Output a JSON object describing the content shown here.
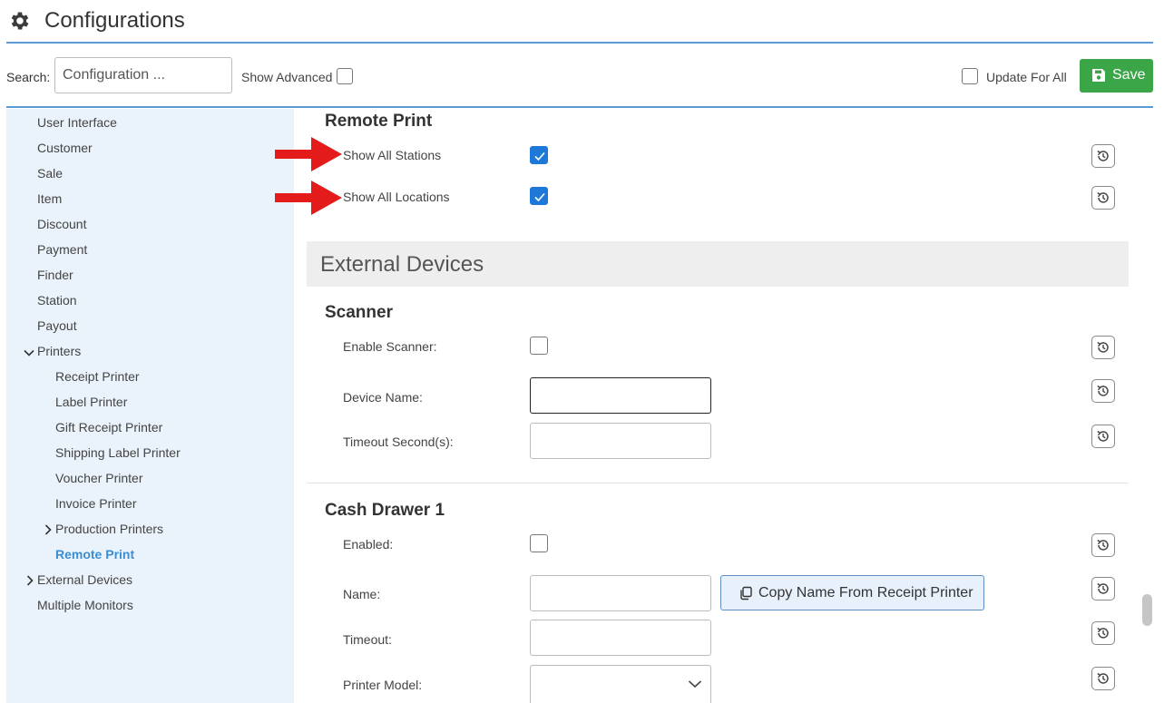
{
  "header": {
    "title": "Configurations",
    "icon": "gear-icon"
  },
  "toolbar": {
    "search_label": "Search:",
    "search_placeholder": "Configuration ...",
    "show_advanced_label": "Show Advanced",
    "show_advanced_checked": false,
    "update_for_all_label": "Update For All",
    "update_for_all_checked": false,
    "save_label": "Save"
  },
  "sidebar": {
    "items": [
      {
        "label": "User Interface"
      },
      {
        "label": "Customer"
      },
      {
        "label": "Sale"
      },
      {
        "label": "Item"
      },
      {
        "label": "Discount"
      },
      {
        "label": "Payment"
      },
      {
        "label": "Finder"
      },
      {
        "label": "Station"
      },
      {
        "label": "Payout"
      },
      {
        "label": "Printers",
        "expanded": true
      },
      {
        "label": "Receipt Printer"
      },
      {
        "label": "Label Printer"
      },
      {
        "label": "Gift Receipt Printer"
      },
      {
        "label": "Shipping Label Printer"
      },
      {
        "label": "Voucher Printer"
      },
      {
        "label": "Invoice Printer"
      },
      {
        "label": "Production Printers",
        "expanded": false
      },
      {
        "label": "Remote Print",
        "active": true
      },
      {
        "label": "External Devices",
        "expanded": false
      },
      {
        "label": "Multiple Monitors"
      }
    ]
  },
  "main": {
    "remote_print": {
      "title": "Remote Print",
      "show_all_stations_label": "Show All Stations",
      "show_all_stations_checked": true,
      "show_all_locations_label": "Show All Locations",
      "show_all_locations_checked": true
    },
    "external_devices": {
      "title": "External Devices"
    },
    "scanner": {
      "title": "Scanner",
      "enable_label": "Enable Scanner:",
      "enable_checked": false,
      "device_name_label": "Device Name:",
      "device_name_value": "",
      "timeout_label": "Timeout Second(s):",
      "timeout_value": ""
    },
    "cash_drawer": {
      "title": "Cash Drawer 1",
      "enabled_label": "Enabled:",
      "enabled_checked": false,
      "name_label": "Name:",
      "name_value": "",
      "copy_button_label": "Copy Name From Receipt Printer",
      "timeout_label": "Timeout:",
      "timeout_value": "",
      "printer_model_label": "Printer Model:",
      "printer_model_value": ""
    }
  },
  "colors": {
    "accent_line": "#5b9bd5",
    "save_green": "#3aa648",
    "checkbox_blue": "#1e78d7",
    "sidebar_bg": "#eaf3fc",
    "active_nav": "#3a8ed4",
    "annotation_arrow": "#e31b1b"
  }
}
